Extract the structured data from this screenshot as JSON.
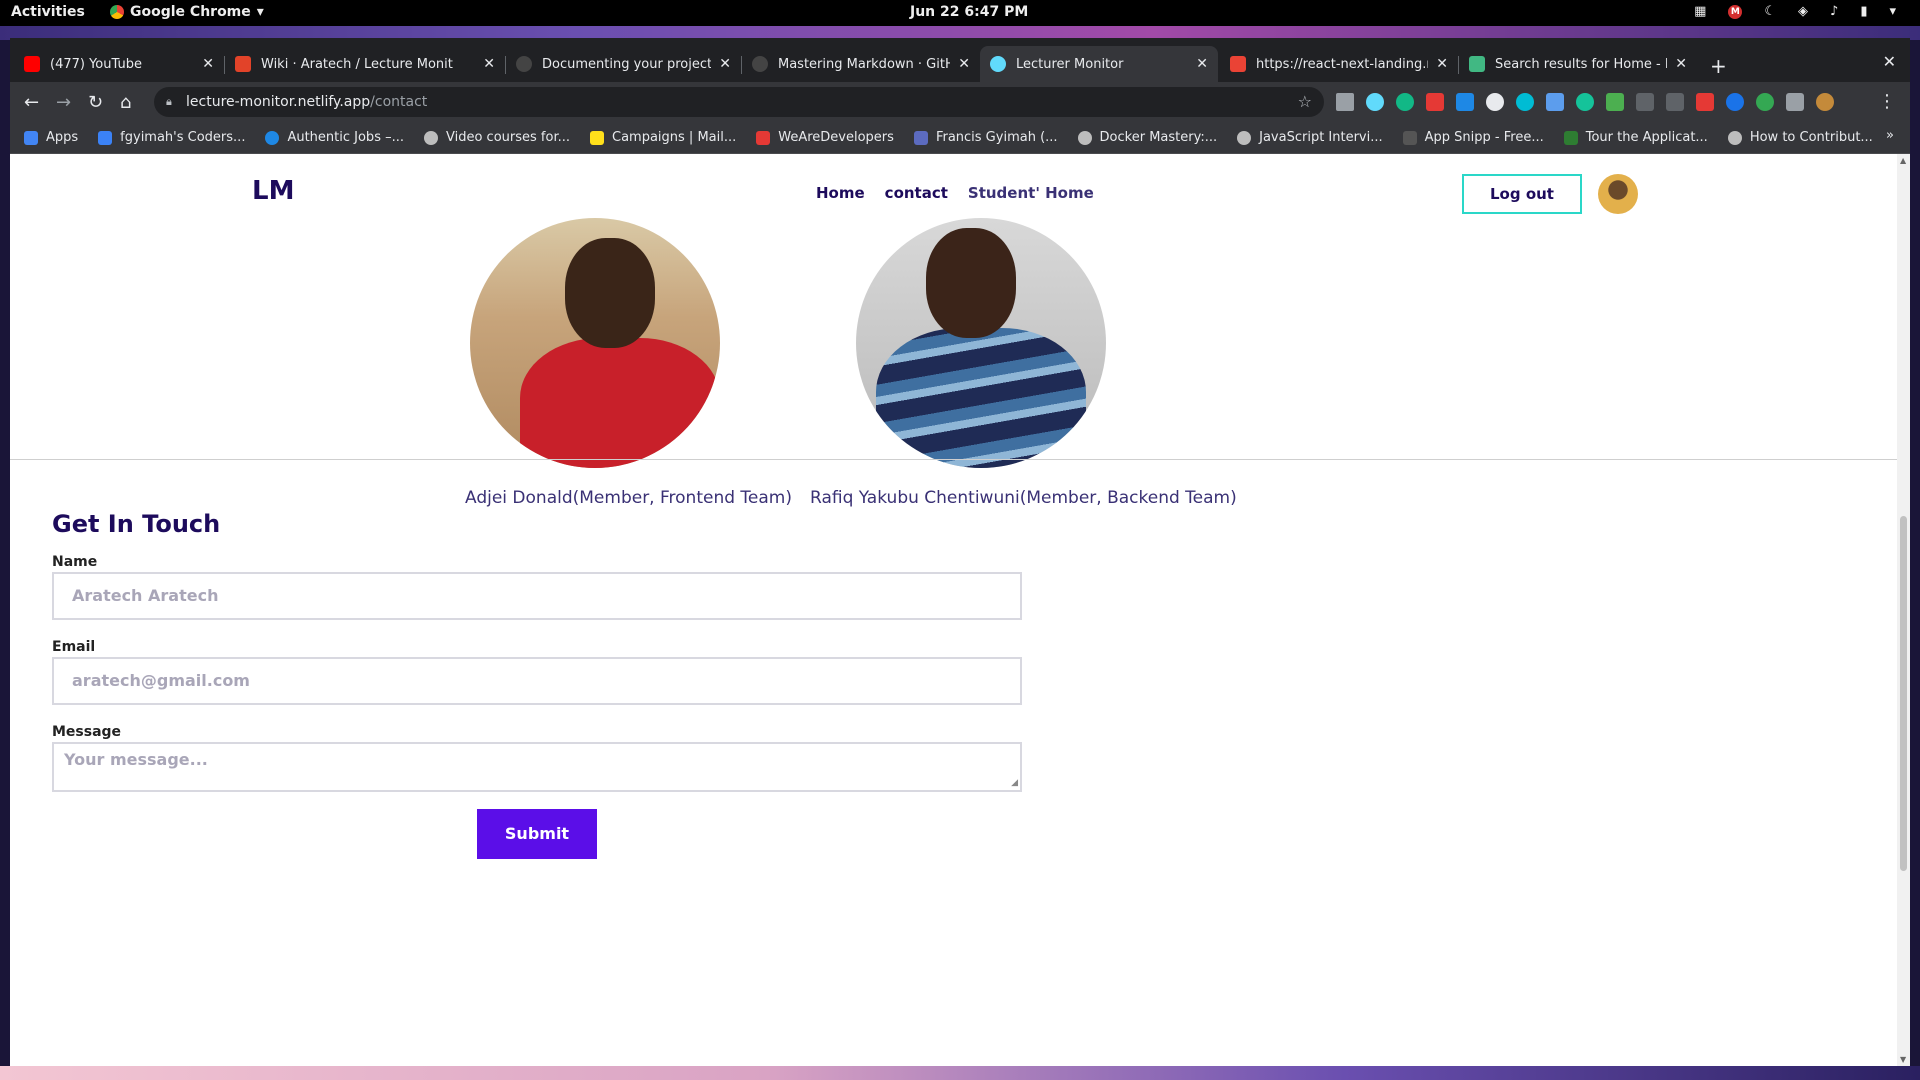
{
  "os": {
    "activities": "Activities",
    "app_name": "Google Chrome",
    "clock": "Jun 22  6:47 PM"
  },
  "tabs": [
    {
      "title": "(477) YouTube",
      "icon": "youtube-icon",
      "color": "#ff0000"
    },
    {
      "title": "Wiki · Aratech / Lecture Monit",
      "icon": "gitlab-icon",
      "color": "#e24329"
    },
    {
      "title": "Documenting your projects o",
      "icon": "github-icon",
      "color": "#444444"
    },
    {
      "title": "Mastering Markdown · GitHub",
      "icon": "github-icon",
      "color": "#444444"
    },
    {
      "title": "Lecturer Monitor",
      "icon": "react-icon",
      "color": "#61dafb"
    },
    {
      "title": "https://react-next-landing.re",
      "icon": "gmail-icon",
      "color": "#ea4335"
    },
    {
      "title": "Search results for Home - Fla",
      "icon": "vue-icon",
      "color": "#41b883"
    }
  ],
  "omnibox": {
    "host": "lecture-monitor.netlify.app",
    "path": "/contact"
  },
  "bookmarks": [
    {
      "label": "Apps",
      "color": "#4285f4"
    },
    {
      "label": "fgyimah's Coders...",
      "color": "#3b82f6"
    },
    {
      "label": "Authentic Jobs –...",
      "color": "#1e88e5"
    },
    {
      "label": "Video courses for...",
      "color": "#bdbdbd"
    },
    {
      "label": "Campaigns | Mail...",
      "color": "#ffe01b"
    },
    {
      "label": "WeAreDevelopers",
      "color": "#e53935"
    },
    {
      "label": "Francis Gyimah (...",
      "color": "#5c6bc0"
    },
    {
      "label": "Docker Mastery:...",
      "color": "#bdbdbd"
    },
    {
      "label": "JavaScript Intervi...",
      "color": "#bdbdbd"
    },
    {
      "label": "App Snipp - Free...",
      "color": "#555555"
    },
    {
      "label": "Tour the Applicat...",
      "color": "#2e7d32"
    },
    {
      "label": "How to Contribut...",
      "color": "#bdbdbd"
    }
  ],
  "site": {
    "logo": "LM",
    "nav": {
      "home": "Home",
      "contact": "contact",
      "student_home": "Student' Home"
    },
    "logout": "Log out"
  },
  "members": [
    {
      "name": "Adjei Donald(Member, Frontend Team)"
    },
    {
      "name": "Rafiq Yakubu Chentiwuni(Member, Backend Team)"
    }
  ],
  "contact": {
    "title": "Get In Touch",
    "name_label": "Name",
    "name_placeholder": "Aratech Aratech",
    "email_label": "Email",
    "email_placeholder": "aratech@gmail.com",
    "message_label": "Message",
    "message_placeholder": "Your message...",
    "submit": "Submit"
  },
  "colors": {
    "brand": "#1d0b5c",
    "accent": "#5b0ee8",
    "logout_border": "#2ad7c8"
  }
}
